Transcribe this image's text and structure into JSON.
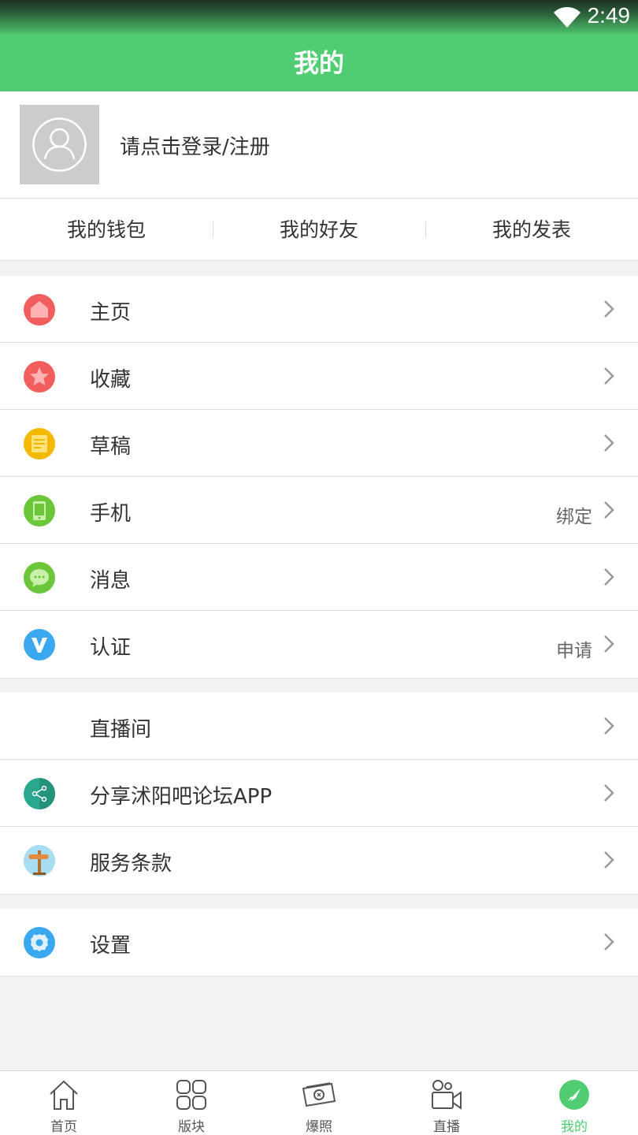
{
  "status_bar": {
    "time": "2:49"
  },
  "header": {
    "title": "我的"
  },
  "profile": {
    "login_text": "请点击登录/注册"
  },
  "quick_links": [
    {
      "label": "我的钱包"
    },
    {
      "label": "我的好友"
    },
    {
      "label": "我的发表"
    }
  ],
  "menu": {
    "group1": [
      {
        "label": "主页",
        "icon": "home-icon",
        "color": "#f25d5d"
      },
      {
        "label": "收藏",
        "icon": "star-icon",
        "color": "#f25d5d"
      },
      {
        "label": "草稿",
        "icon": "draft-icon",
        "color": "#f5b800"
      },
      {
        "label": "手机",
        "icon": "phone-icon",
        "color": "#6cc63a",
        "value": "绑定"
      },
      {
        "label": "消息",
        "icon": "message-icon",
        "color": "#6cc63a"
      },
      {
        "label": "认证",
        "icon": "verify-icon",
        "color": "#3aa7ef",
        "value": "申请"
      }
    ],
    "group2": [
      {
        "label": "直播间"
      },
      {
        "label": "分享沭阳吧论坛APP",
        "icon": "share-icon",
        "color": "#2aa88f"
      },
      {
        "label": "服务条款",
        "icon": "signpost-icon",
        "color": "#a8dcf3"
      }
    ],
    "group3": [
      {
        "label": "设置",
        "icon": "settings-icon",
        "color": "#3aa7ef"
      }
    ]
  },
  "tabbar": [
    {
      "label": "首页",
      "icon": "home-outline-icon"
    },
    {
      "label": "版块",
      "icon": "grid-icon"
    },
    {
      "label": "爆照",
      "icon": "photo-icon"
    },
    {
      "label": "直播",
      "icon": "video-icon"
    },
    {
      "label": "我的",
      "icon": "compass-icon",
      "active": true
    }
  ],
  "colors": {
    "accent": "#50cc73"
  }
}
